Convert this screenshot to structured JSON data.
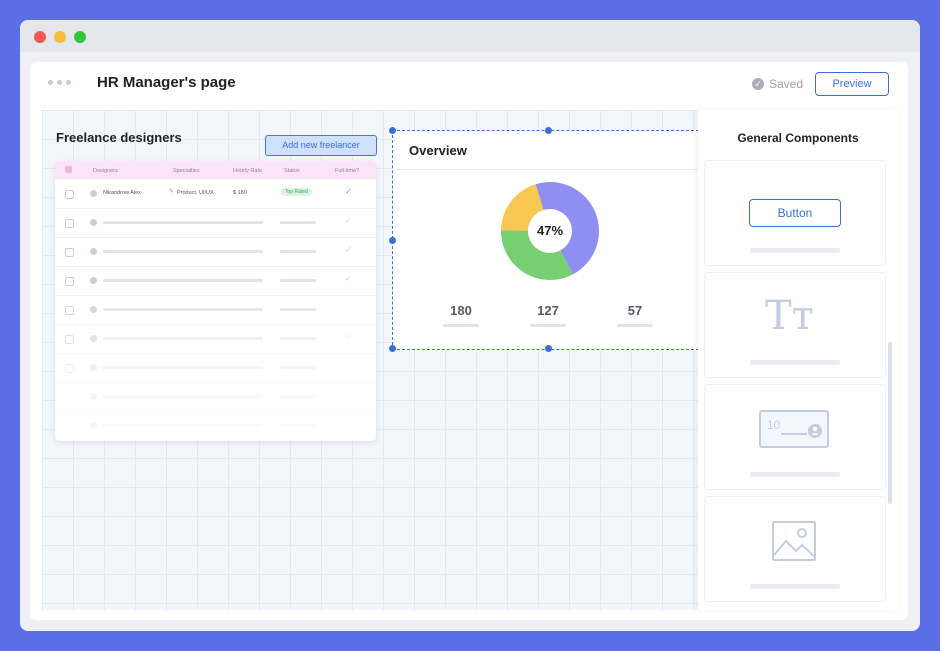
{
  "window": {
    "controls": [
      "close",
      "minimize",
      "maximize"
    ]
  },
  "header": {
    "menu_icon": "more-dots-icon",
    "title": "HR Manager's page",
    "saved_label": "Saved",
    "saved_icon": "check-circle-icon",
    "preview_label": "Preview"
  },
  "freelance": {
    "title": "Freelance designers",
    "add_label": "Add new freelancer",
    "columns": [
      "Designers",
      "Specialties",
      "Hourly Rate",
      "Status",
      "Full-time?"
    ],
    "first_row": {
      "name": "Nikandrow Alex",
      "specialty": "Product, UI/UX",
      "rate": "$ 180",
      "status": "Top Rated",
      "full_time": "✓"
    }
  },
  "overview": {
    "title": "Overview",
    "center_label": "47%",
    "stats": [
      "180",
      "127",
      "57"
    ],
    "slices": [
      {
        "name": "purple",
        "value": 47,
        "color": "#8e8ff0"
      },
      {
        "name": "green",
        "value": 33,
        "color": "#78cf72"
      },
      {
        "name": "yellow",
        "value": 20,
        "color": "#f9c853"
      }
    ]
  },
  "components": {
    "title": "General Components",
    "button_label": "Button",
    "items": [
      "button-component",
      "text-component",
      "input-component",
      "image-component"
    ],
    "text_icon_label": "Tт",
    "input_sample": "10"
  },
  "colors": {
    "accent": "#3b6fd8",
    "background": "#5a6ee6"
  }
}
